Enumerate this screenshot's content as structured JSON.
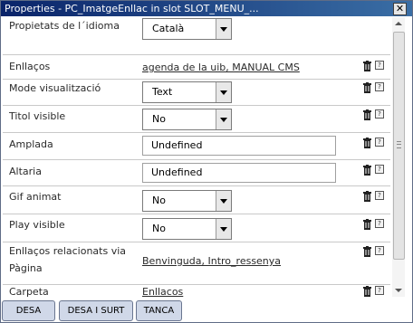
{
  "window": {
    "title": "Properties - PC_ImatgeEnllac in slot SLOT_MENU_...",
    "close_label": "✕"
  },
  "rows": {
    "idioma": {
      "label": "Propietats de l´idioma",
      "value": "Català"
    },
    "enllacos": {
      "label": "Enllaços",
      "value": "agenda de la uib, MANUAL CMS"
    },
    "mode": {
      "label": "Mode visualització",
      "value": "Text"
    },
    "titol": {
      "label": "Titol visible",
      "value": "No"
    },
    "amplada": {
      "label": "Amplada",
      "value": "Undefined"
    },
    "altaria": {
      "label": "Altaria",
      "value": "Undefined"
    },
    "gif": {
      "label": "Gif animat",
      "value": "No"
    },
    "play": {
      "label": "Play visible",
      "value": "No"
    },
    "relacionats": {
      "label_line1": "Enllaços relacionats via",
      "label_line2": "Pàgina",
      "value": "Benvinguda, Intro_ressenya"
    },
    "carpeta": {
      "label": "Carpeta",
      "value": "Enllacos"
    }
  },
  "icons": {
    "delete": "trash-icon",
    "help": "help-icon",
    "help_glyph": "?"
  },
  "buttons": {
    "save": "DESA",
    "save_exit": "DESA I SURT",
    "close": "TANCA"
  }
}
